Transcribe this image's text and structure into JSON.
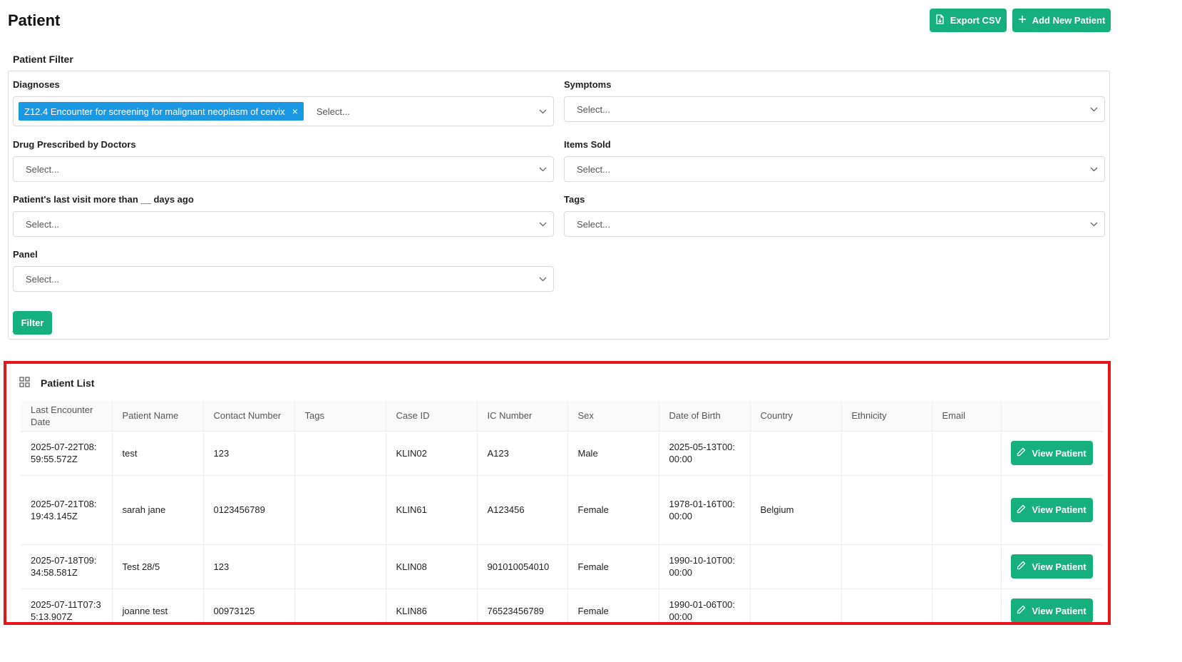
{
  "page": {
    "title": "Patient"
  },
  "toolbar": {
    "export_label": "Export CSV",
    "add_label": "Add New Patient"
  },
  "filter": {
    "title": "Patient Filter",
    "diagnoses": {
      "label": "Diagnoses",
      "chip": "Z12.4 Encounter for screening for malignant neoplasm of cervix",
      "placeholder": "Select..."
    },
    "symptoms": {
      "label": "Symptoms",
      "placeholder": "Select..."
    },
    "drug": {
      "label": "Drug Prescribed by Doctors",
      "placeholder": "Select..."
    },
    "items_sold": {
      "label": "Items Sold",
      "placeholder": "Select..."
    },
    "last_visit": {
      "label": "Patient's last visit more than __ days ago",
      "placeholder": "Select..."
    },
    "tags": {
      "label": "Tags",
      "placeholder": "Select..."
    },
    "panel": {
      "label": "Panel",
      "placeholder": "Select..."
    },
    "filter_label": "Filter"
  },
  "list": {
    "title": "Patient List",
    "columns": [
      "Last Encounter Date",
      "Patient Name",
      "Contact Number",
      "Tags",
      "Case ID",
      "IC Number",
      "Sex",
      "Date of Birth",
      "Country",
      "Ethnicity",
      "Email",
      ""
    ],
    "view_label": "View Patient",
    "rows": [
      {
        "last_encounter": "2025-07-22T08:59:55.572Z",
        "name": "test",
        "contact": "123",
        "tags": "",
        "case_id": "KLIN02",
        "ic": "A123",
        "sex": "Male",
        "dob": "2025-05-13T00:00:00",
        "country": "",
        "ethnicity": "",
        "email": ""
      },
      {
        "last_encounter": "2025-07-21T08:19:43.145Z",
        "name": "sarah jane",
        "contact": "0123456789",
        "tags": "",
        "case_id": "KLIN61",
        "ic": "A123456",
        "sex": "Female",
        "dob": "1978-01-16T00:00:00",
        "country": "Belgium",
        "ethnicity": "",
        "email": ""
      },
      {
        "last_encounter": "2025-07-18T09:34:58.581Z",
        "name": "Test 28/5",
        "contact": "123",
        "tags": "",
        "case_id": "KLIN08",
        "ic": "901010054010",
        "sex": "Female",
        "dob": "1990-10-10T00:00:00",
        "country": "",
        "ethnicity": "",
        "email": ""
      },
      {
        "last_encounter": "2025-07-11T07:35:13.907Z",
        "name": "joanne test",
        "contact": "00973125",
        "tags": "",
        "case_id": "KLIN86",
        "ic": "76523456789",
        "sex": "Female",
        "dob": "1990-01-06T00:00:00",
        "country": "",
        "ethnicity": "",
        "email": ""
      }
    ]
  },
  "colors": {
    "accent_green": "#16b07e",
    "chip_blue": "#1a98e4",
    "highlight_red": "#e8141c"
  }
}
